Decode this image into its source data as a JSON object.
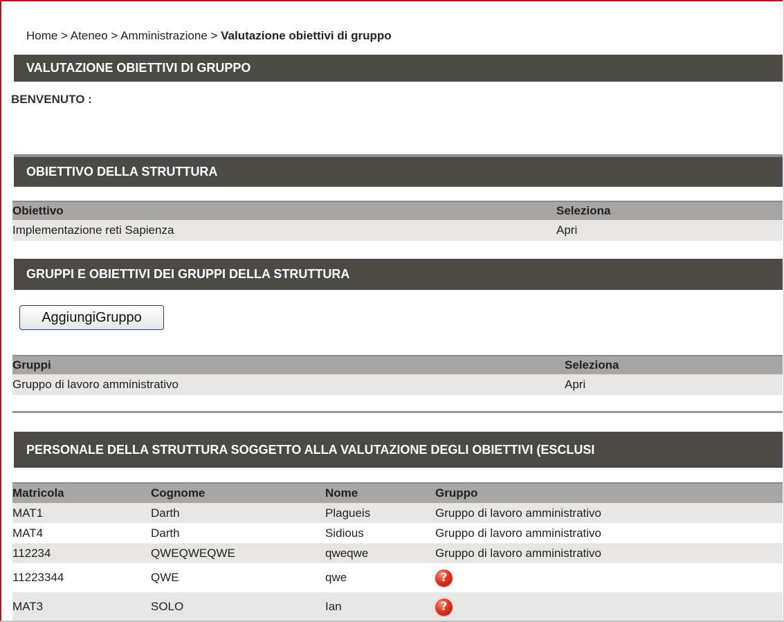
{
  "breadcrumb": {
    "home": "Home",
    "sep1": " > ",
    "ateneo": "Ateneo",
    "sep2": " > ",
    "amministrazione": "Amministrazione",
    "sep3": " > ",
    "current": "Valutazione obiettivi di gruppo"
  },
  "page_title": "VALUTAZIONE OBIETTIVI DI GRUPPO",
  "welcome": "BENVENUTO :",
  "objective_section": {
    "title": "OBIETTIVO DELLA STRUTTURA",
    "columns": [
      "Obiettivo",
      "Seleziona"
    ],
    "rows": [
      {
        "name": "Implementazione reti Sapienza",
        "action": "Apri"
      }
    ]
  },
  "groups_section": {
    "title": "GRUPPI E OBIETTIVI DEI GRUPPI DELLA STRUTTURA",
    "add_button": "AggiungiGruppo",
    "columns": [
      "Gruppi",
      "Seleziona"
    ],
    "rows": [
      {
        "name": "Gruppo di lavoro amministrativo",
        "action": "Apri"
      }
    ]
  },
  "staff_section": {
    "title": "PERSONALE DELLA STRUTTURA SOGGETTO ALLA VALUTAZIONE DEGLI OBIETTIVI (ESCLUSI",
    "columns": [
      "Matricola",
      "Cognome",
      "Nome",
      "Gruppo"
    ],
    "rows": [
      {
        "matricola": "MAT1",
        "cognome": "Darth",
        "nome": "Plagueis",
        "gruppo": "Gruppo di lavoro amministrativo"
      },
      {
        "matricola": "MAT4",
        "cognome": "Darth",
        "nome": "Sidious",
        "gruppo": "Gruppo di lavoro amministrativo"
      },
      {
        "matricola": "112234",
        "cognome": "QWEQWEQWE",
        "nome": "qweqwe",
        "gruppo": "Gruppo di lavoro amministrativo"
      },
      {
        "matricola": "11223344",
        "cognome": "QWE",
        "nome": "qwe",
        "gruppo": ""
      },
      {
        "matricola": "MAT3",
        "cognome": "SOLO",
        "nome": "Ian",
        "gruppo": ""
      }
    ],
    "unassigned_icon": "question-icon",
    "unassigned_glyph": "?"
  },
  "colors": {
    "header_bar": "#4d4a46",
    "table_header": "#a8a6a4",
    "row_shade": "#e7e6e5",
    "frame_accent": "#b01818",
    "alert_icon": "#e5301c"
  }
}
